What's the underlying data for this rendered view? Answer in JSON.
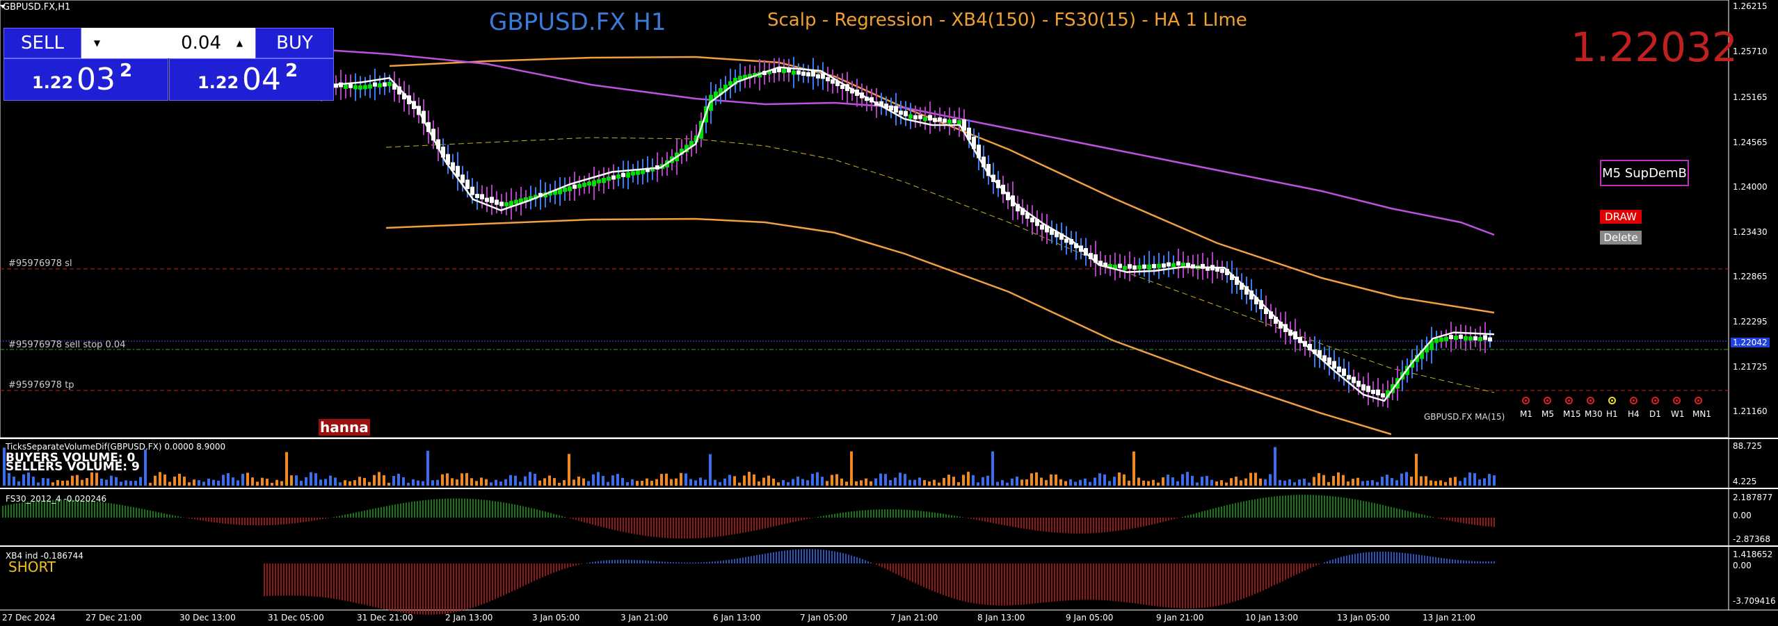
{
  "symbol_header": "GBPUSD.FX,H1",
  "chart_title": "GBPUSD.FX H1",
  "strategy_title": "Scalp - Regression - XB4(150) - FS30(15) - HA  1 LIme",
  "big_price": "1.22032",
  "trade_panel": {
    "sell_label": "SELL",
    "buy_label": "BUY",
    "lot_value": "0.04",
    "sell_price_prefix": "1.22",
    "sell_price_big": "03",
    "sell_price_sup": "2",
    "buy_price_prefix": "1.22",
    "buy_price_big": "04",
    "buy_price_sup": "2"
  },
  "supdem_button": "M5 SupDemB",
  "draw_button": "DRAW",
  "delete_button": "Delete",
  "order_lines": {
    "sl_label": "#95976978 sl",
    "entry_label": "#95976978 sell stop 0.04",
    "tp_label": "#95976978 tp"
  },
  "ma_label": "GBPUSD.FX MA(15)",
  "watermark": "hanna",
  "timeframes": [
    "M1",
    "M5",
    "M15",
    "M30",
    "H1",
    "H4",
    "D1",
    "W1",
    "MN1"
  ],
  "active_timeframe": "H1",
  "price_axis": [
    "1.26215",
    "1.25710",
    "1.25165",
    "1.24565",
    "1.24000",
    "1.23430",
    "1.22865",
    "1.22295",
    "1.22042",
    "1.21725",
    "1.21160"
  ],
  "current_price_tag": "1.22042",
  "volume_panel": {
    "title": "TicksSeparateVolumeDif(GBPUSD.FX) 0.0000 8.9000",
    "buyers": "BUYERS VOLUME: 0",
    "sellers": "SELLERS VOLUME: 9",
    "axis_top": "88.725",
    "axis_bottom": "4.225"
  },
  "fs30_panel": {
    "title": "FS30_2012_4 -0.020246",
    "axis_top": "2.187877",
    "axis_mid": "0.00",
    "axis_bottom": "-2.87368"
  },
  "xb4_panel": {
    "title": "XB4 ind -0.186744",
    "signal": "SHORT",
    "axis_top": "1.418652",
    "axis_mid": "0.00",
    "axis_bottom": "-3.709416"
  },
  "time_axis": [
    "27 Dec 2024",
    "27 Dec 21:00",
    "30 Dec 13:00",
    "31 Dec 05:00",
    "31 Dec 21:00",
    "2 Jan 13:00",
    "3 Jan 05:00",
    "3 Jan 21:00",
    "6 Jan 13:00",
    "7 Jan 05:00",
    "7 Jan 21:00",
    "8 Jan 13:00",
    "9 Jan 05:00",
    "9 Jan 21:00",
    "10 Jan 13:00",
    "13 Jan 05:00",
    "13 Jan 21:00"
  ],
  "colors": {
    "background": "#000000",
    "panel_blue": "#1f1fd6",
    "bear_candle": "#ffffff",
    "bull_candle": "#00e000",
    "wick_purple": "#b040c0",
    "wick_blue": "#3a7af0",
    "regression_orange": "#f0a040",
    "slow_ma_violet": "#c050e0",
    "title_blue": "#3a7ad8",
    "title_orange": "#f0a030",
    "big_price_red": "#c02020",
    "order_line_red": "#c02020",
    "order_line_blue": "#4060ff",
    "order_line_green": "#20b020"
  }
}
